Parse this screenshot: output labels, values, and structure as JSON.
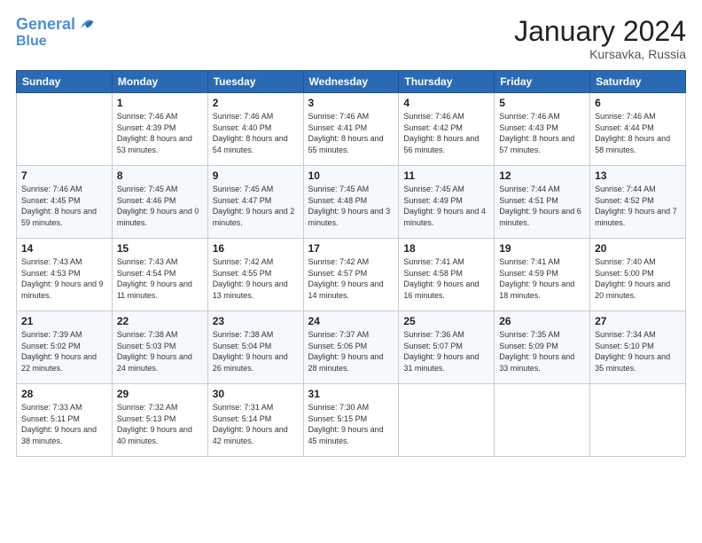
{
  "header": {
    "logo_line1": "General",
    "logo_line2": "Blue",
    "month_title": "January 2024",
    "location": "Kursavka, Russia"
  },
  "weekdays": [
    "Sunday",
    "Monday",
    "Tuesday",
    "Wednesday",
    "Thursday",
    "Friday",
    "Saturday"
  ],
  "weeks": [
    [
      {
        "day": "",
        "sunrise": "",
        "sunset": "",
        "daylight": ""
      },
      {
        "day": "1",
        "sunrise": "Sunrise: 7:46 AM",
        "sunset": "Sunset: 4:39 PM",
        "daylight": "Daylight: 8 hours and 53 minutes."
      },
      {
        "day": "2",
        "sunrise": "Sunrise: 7:46 AM",
        "sunset": "Sunset: 4:40 PM",
        "daylight": "Daylight: 8 hours and 54 minutes."
      },
      {
        "day": "3",
        "sunrise": "Sunrise: 7:46 AM",
        "sunset": "Sunset: 4:41 PM",
        "daylight": "Daylight: 8 hours and 55 minutes."
      },
      {
        "day": "4",
        "sunrise": "Sunrise: 7:46 AM",
        "sunset": "Sunset: 4:42 PM",
        "daylight": "Daylight: 8 hours and 56 minutes."
      },
      {
        "day": "5",
        "sunrise": "Sunrise: 7:46 AM",
        "sunset": "Sunset: 4:43 PM",
        "daylight": "Daylight: 8 hours and 57 minutes."
      },
      {
        "day": "6",
        "sunrise": "Sunrise: 7:46 AM",
        "sunset": "Sunset: 4:44 PM",
        "daylight": "Daylight: 8 hours and 58 minutes."
      }
    ],
    [
      {
        "day": "7",
        "sunrise": "Sunrise: 7:46 AM",
        "sunset": "Sunset: 4:45 PM",
        "daylight": "Daylight: 8 hours and 59 minutes."
      },
      {
        "day": "8",
        "sunrise": "Sunrise: 7:45 AM",
        "sunset": "Sunset: 4:46 PM",
        "daylight": "Daylight: 9 hours and 0 minutes."
      },
      {
        "day": "9",
        "sunrise": "Sunrise: 7:45 AM",
        "sunset": "Sunset: 4:47 PM",
        "daylight": "Daylight: 9 hours and 2 minutes."
      },
      {
        "day": "10",
        "sunrise": "Sunrise: 7:45 AM",
        "sunset": "Sunset: 4:48 PM",
        "daylight": "Daylight: 9 hours and 3 minutes."
      },
      {
        "day": "11",
        "sunrise": "Sunrise: 7:45 AM",
        "sunset": "Sunset: 4:49 PM",
        "daylight": "Daylight: 9 hours and 4 minutes."
      },
      {
        "day": "12",
        "sunrise": "Sunrise: 7:44 AM",
        "sunset": "Sunset: 4:51 PM",
        "daylight": "Daylight: 9 hours and 6 minutes."
      },
      {
        "day": "13",
        "sunrise": "Sunrise: 7:44 AM",
        "sunset": "Sunset: 4:52 PM",
        "daylight": "Daylight: 9 hours and 7 minutes."
      }
    ],
    [
      {
        "day": "14",
        "sunrise": "Sunrise: 7:43 AM",
        "sunset": "Sunset: 4:53 PM",
        "daylight": "Daylight: 9 hours and 9 minutes."
      },
      {
        "day": "15",
        "sunrise": "Sunrise: 7:43 AM",
        "sunset": "Sunset: 4:54 PM",
        "daylight": "Daylight: 9 hours and 11 minutes."
      },
      {
        "day": "16",
        "sunrise": "Sunrise: 7:42 AM",
        "sunset": "Sunset: 4:55 PM",
        "daylight": "Daylight: 9 hours and 13 minutes."
      },
      {
        "day": "17",
        "sunrise": "Sunrise: 7:42 AM",
        "sunset": "Sunset: 4:57 PM",
        "daylight": "Daylight: 9 hours and 14 minutes."
      },
      {
        "day": "18",
        "sunrise": "Sunrise: 7:41 AM",
        "sunset": "Sunset: 4:58 PM",
        "daylight": "Daylight: 9 hours and 16 minutes."
      },
      {
        "day": "19",
        "sunrise": "Sunrise: 7:41 AM",
        "sunset": "Sunset: 4:59 PM",
        "daylight": "Daylight: 9 hours and 18 minutes."
      },
      {
        "day": "20",
        "sunrise": "Sunrise: 7:40 AM",
        "sunset": "Sunset: 5:00 PM",
        "daylight": "Daylight: 9 hours and 20 minutes."
      }
    ],
    [
      {
        "day": "21",
        "sunrise": "Sunrise: 7:39 AM",
        "sunset": "Sunset: 5:02 PM",
        "daylight": "Daylight: 9 hours and 22 minutes."
      },
      {
        "day": "22",
        "sunrise": "Sunrise: 7:38 AM",
        "sunset": "Sunset: 5:03 PM",
        "daylight": "Daylight: 9 hours and 24 minutes."
      },
      {
        "day": "23",
        "sunrise": "Sunrise: 7:38 AM",
        "sunset": "Sunset: 5:04 PM",
        "daylight": "Daylight: 9 hours and 26 minutes."
      },
      {
        "day": "24",
        "sunrise": "Sunrise: 7:37 AM",
        "sunset": "Sunset: 5:06 PM",
        "daylight": "Daylight: 9 hours and 28 minutes."
      },
      {
        "day": "25",
        "sunrise": "Sunrise: 7:36 AM",
        "sunset": "Sunset: 5:07 PM",
        "daylight": "Daylight: 9 hours and 31 minutes."
      },
      {
        "day": "26",
        "sunrise": "Sunrise: 7:35 AM",
        "sunset": "Sunset: 5:09 PM",
        "daylight": "Daylight: 9 hours and 33 minutes."
      },
      {
        "day": "27",
        "sunrise": "Sunrise: 7:34 AM",
        "sunset": "Sunset: 5:10 PM",
        "daylight": "Daylight: 9 hours and 35 minutes."
      }
    ],
    [
      {
        "day": "28",
        "sunrise": "Sunrise: 7:33 AM",
        "sunset": "Sunset: 5:11 PM",
        "daylight": "Daylight: 9 hours and 38 minutes."
      },
      {
        "day": "29",
        "sunrise": "Sunrise: 7:32 AM",
        "sunset": "Sunset: 5:13 PM",
        "daylight": "Daylight: 9 hours and 40 minutes."
      },
      {
        "day": "30",
        "sunrise": "Sunrise: 7:31 AM",
        "sunset": "Sunset: 5:14 PM",
        "daylight": "Daylight: 9 hours and 42 minutes."
      },
      {
        "day": "31",
        "sunrise": "Sunrise: 7:30 AM",
        "sunset": "Sunset: 5:15 PM",
        "daylight": "Daylight: 9 hours and 45 minutes."
      },
      {
        "day": "",
        "sunrise": "",
        "sunset": "",
        "daylight": ""
      },
      {
        "day": "",
        "sunrise": "",
        "sunset": "",
        "daylight": ""
      },
      {
        "day": "",
        "sunrise": "",
        "sunset": "",
        "daylight": ""
      }
    ]
  ]
}
